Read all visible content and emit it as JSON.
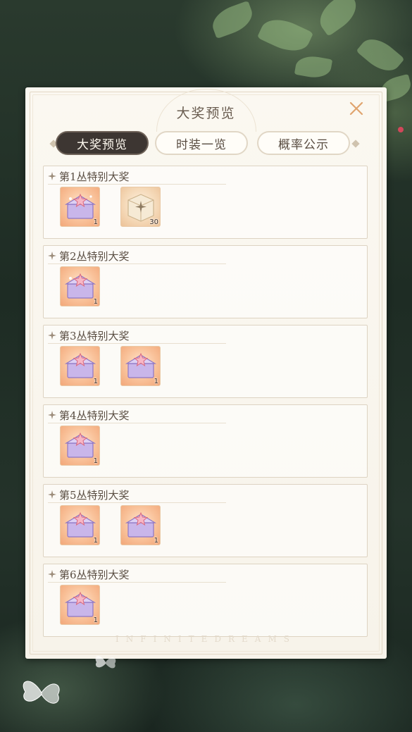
{
  "dialog": {
    "title": "大奖预览",
    "close_icon": "close-icon"
  },
  "tabs": [
    {
      "label": "大奖预览",
      "active": true
    },
    {
      "label": "时装一览",
      "active": false
    },
    {
      "label": "概率公示",
      "active": false
    }
  ],
  "sections": [
    {
      "label": "第1丛特别大奖",
      "items": [
        {
          "icon": "gift-chest-icon",
          "count": "1"
        },
        {
          "icon": "star-box-icon",
          "count": "30"
        }
      ]
    },
    {
      "label": "第2丛特别大奖",
      "items": [
        {
          "icon": "gift-chest-icon",
          "count": "1"
        }
      ]
    },
    {
      "label": "第3丛特别大奖",
      "items": [
        {
          "icon": "gift-chest-icon",
          "count": "1"
        },
        {
          "icon": "gift-chest-icon",
          "count": "1"
        }
      ]
    },
    {
      "label": "第4丛特别大奖",
      "items": [
        {
          "icon": "gift-chest-icon",
          "count": "1"
        }
      ]
    },
    {
      "label": "第5丛特别大奖",
      "items": [
        {
          "icon": "gift-chest-icon",
          "count": "1"
        },
        {
          "icon": "gift-chest-icon",
          "count": "1"
        }
      ]
    },
    {
      "label": "第6丛特别大奖",
      "items": [
        {
          "icon": "gift-chest-icon",
          "count": "1"
        }
      ]
    }
  ],
  "footer_watermark": "INFINITEDREAMS",
  "colors": {
    "panel_bg": "#f9f5ec",
    "active_tab": "#3d3632",
    "close_x": "#e0a46e",
    "item_orange": "#f6b689"
  }
}
